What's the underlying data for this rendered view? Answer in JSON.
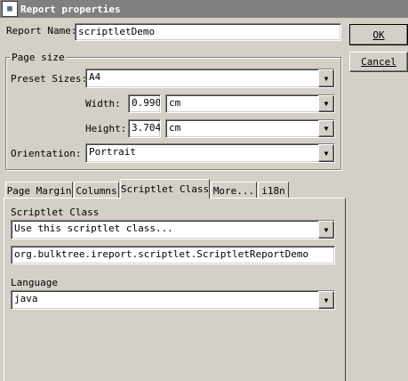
{
  "window": {
    "title": "Report properties",
    "icon": "report-icon"
  },
  "report_name": {
    "label": "Report Name:",
    "value": "scriptletDemo"
  },
  "buttons": {
    "ok": "OK",
    "cancel": "Cancel"
  },
  "page_size": {
    "legend": "Page size",
    "preset_label": "Preset Sizes:",
    "preset_value": "A4",
    "width_label": "Width:",
    "width_value": "0.990",
    "width_unit": "cm",
    "height_label": "Height:",
    "height_value": "3.704",
    "height_unit": "cm"
  },
  "orientation": {
    "label": "Orientation:",
    "value": "Portrait"
  },
  "tabs": [
    {
      "label": "Page Margin",
      "active": false
    },
    {
      "label": "Columns",
      "active": false
    },
    {
      "label": "Scriptlet Class",
      "active": true
    },
    {
      "label": "More...",
      "active": false
    },
    {
      "label": "i18n",
      "active": false
    }
  ],
  "scriptlet": {
    "section_label": "Scriptlet Class",
    "mode_value": "Use this scriptlet class...",
    "class_value": "org.bulktree.ireport.scriptlet.ScriptletReportDemo",
    "language_label": "Language",
    "language_value": "java"
  }
}
